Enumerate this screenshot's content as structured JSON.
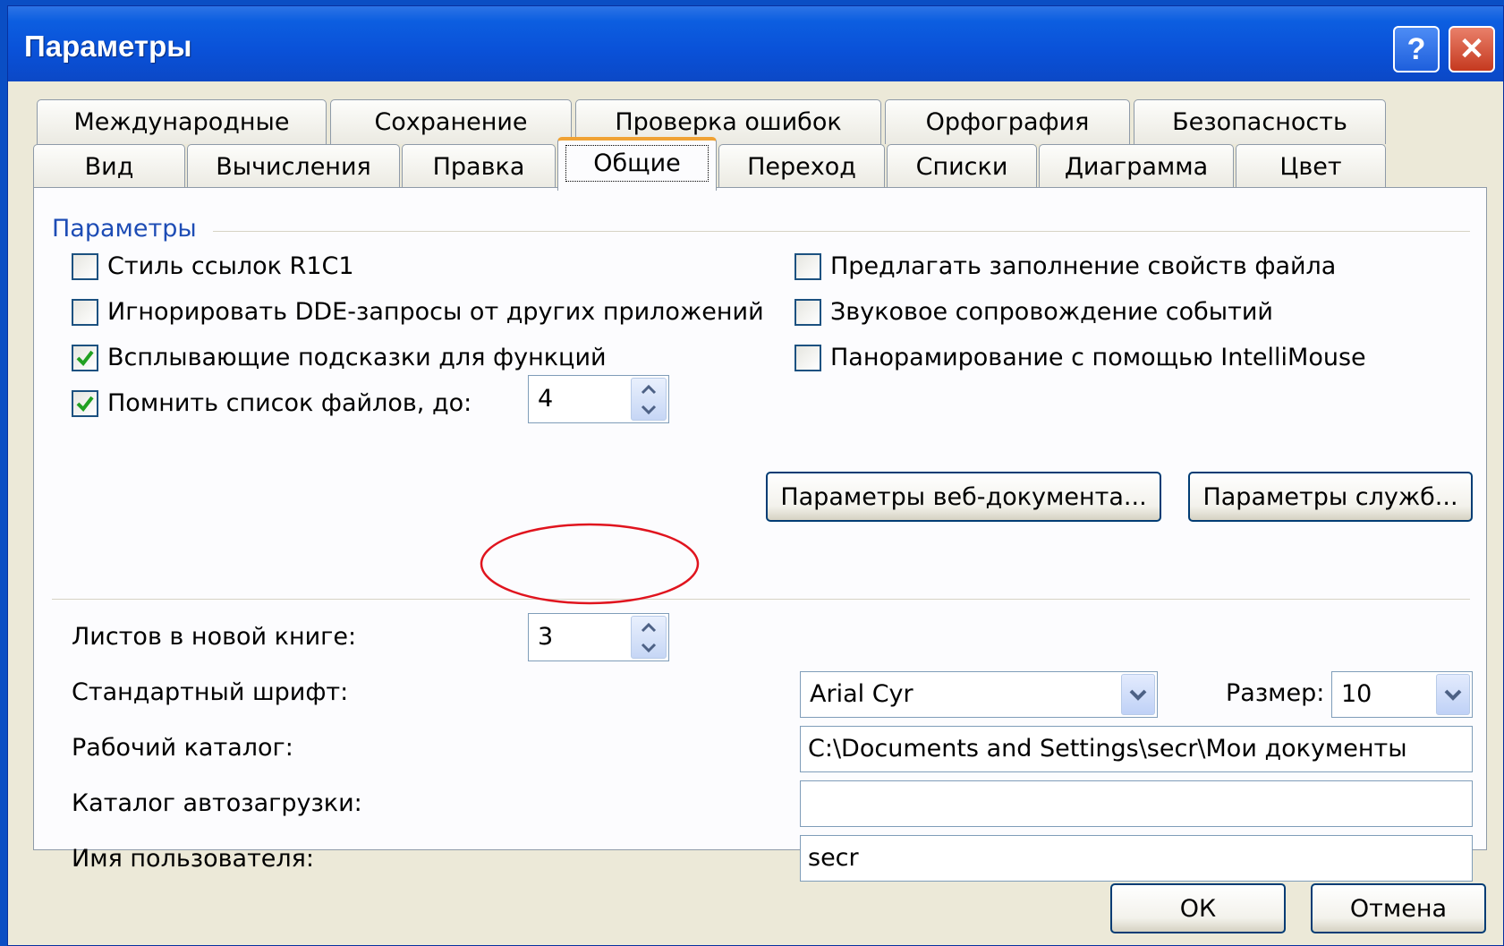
{
  "window": {
    "title": "Параметры",
    "help_glyph": "?",
    "close_glyph": "✕"
  },
  "tabs_row1": [
    "Международные",
    "Сохранение",
    "Проверка ошибок",
    "Орфография",
    "Безопасность"
  ],
  "tabs_row2": [
    "Вид",
    "Вычисления",
    "Правка",
    "Общие",
    "Переход",
    "Списки",
    "Диаграмма",
    "Цвет"
  ],
  "active_tab": "Общие",
  "group": {
    "label": "Параметры"
  },
  "checkboxes": [
    {
      "label": "Стиль ссылок R1C1",
      "checked": false
    },
    {
      "label": "Игнорировать DDE-запросы от других приложений",
      "checked": false
    },
    {
      "label": "Всплывающие подсказки для функций",
      "checked": true
    },
    {
      "label": "Помнить список файлов, до:",
      "checked": true
    },
    {
      "label": "Предлагать заполнение свойств файла",
      "checked": false
    },
    {
      "label": "Звуковое сопровождение событий",
      "checked": false
    },
    {
      "label": "Панорамирование с помощью IntelliMouse",
      "checked": false
    }
  ],
  "recent_files_count": "4",
  "buttons": {
    "web_options": "Параметры веб-документа...",
    "service_options": "Параметры служб...",
    "ok": "ОК",
    "cancel": "Отмена"
  },
  "fields": {
    "sheets_label": "Листов в новой книге:",
    "sheets_value": "3",
    "font_label": "Стандартный шрифт:",
    "font_value": "Arial Cyr",
    "size_label": "Размер:",
    "size_value": "10",
    "workdir_label": "Рабочий каталог:",
    "workdir_value": "C:\\Documents and Settings\\secr\\Мои документы",
    "autoload_label": "Каталог автозагрузки:",
    "autoload_value": "",
    "username_label": "Имя пользователя:",
    "username_value": "secr"
  },
  "colors": {
    "titlebar": "#0a51d8",
    "accent_tab": "#f0a234",
    "annotation": "#e0141e",
    "check": "#21a121"
  }
}
